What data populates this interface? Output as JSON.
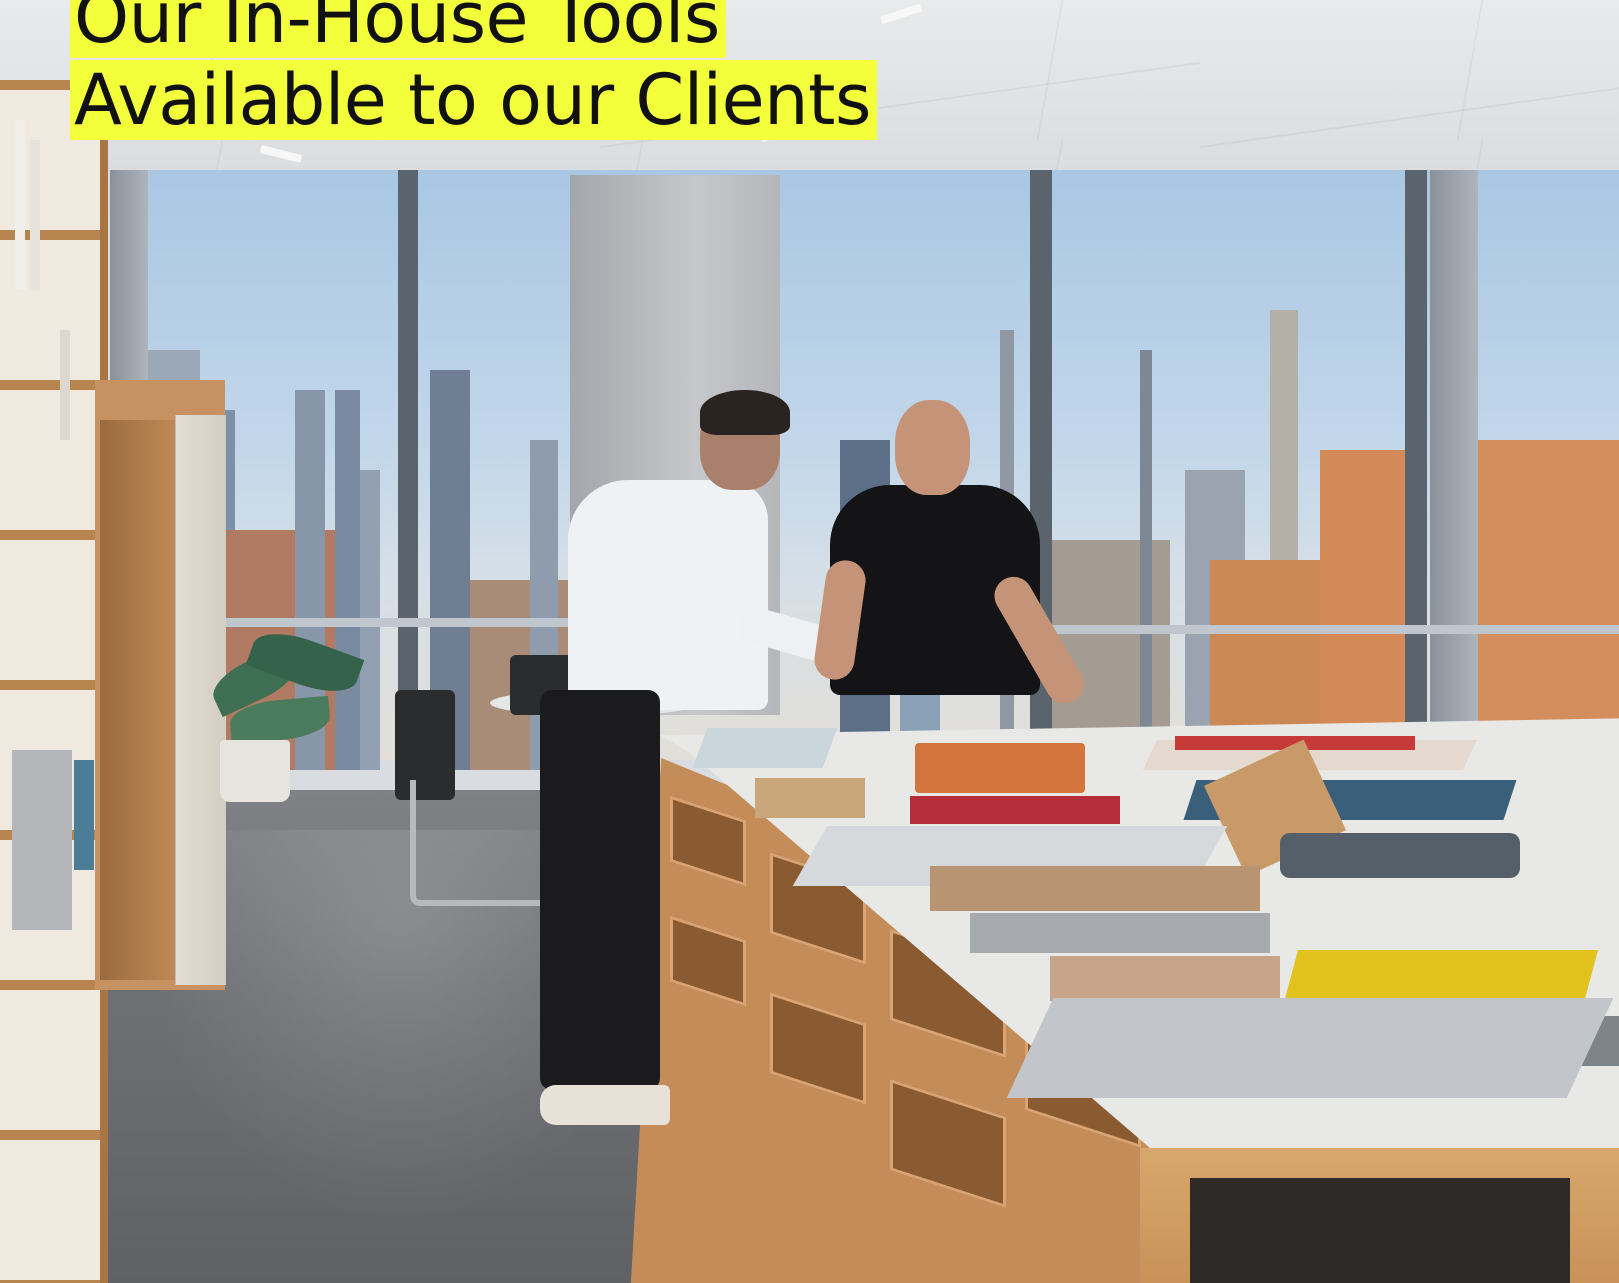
{
  "headline": {
    "line1": "Our In-House Tools",
    "line2": "Available to our Clients"
  },
  "colors": {
    "highlight": "#f4ff3c",
    "text": "#111111"
  },
  "photo": {
    "subject": "photo"
  }
}
